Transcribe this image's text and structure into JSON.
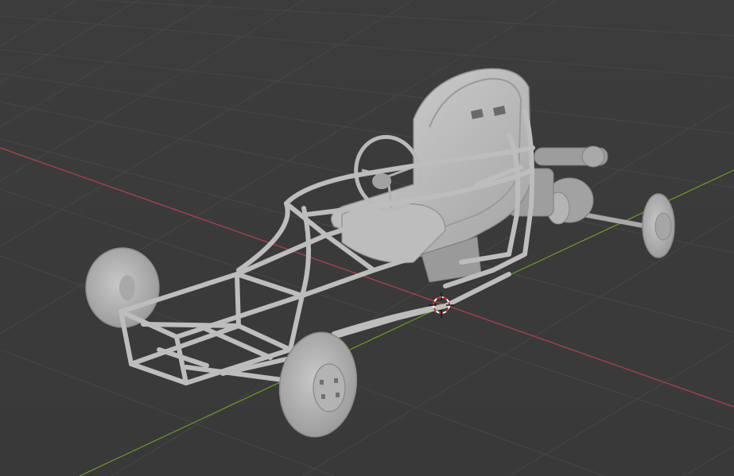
{
  "viewport": {
    "background_color": "#3b3b3b",
    "grid_color": "#474747",
    "x_axis_color": "#b34252",
    "y_axis_color": "#6e9a2e",
    "object_color": "#b9b9b9",
    "object_shadow_color": "#8a8a8a",
    "object_highlight_color": "#d6d6d6",
    "cursor_icon": "3d-cursor-icon",
    "model": "buggy-frame-model"
  }
}
